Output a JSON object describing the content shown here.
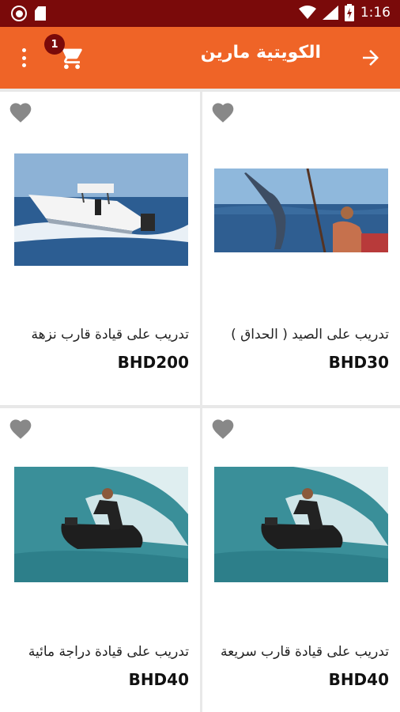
{
  "status_bar": {
    "time": "1:16"
  },
  "app_bar": {
    "title": "الكويتية مارين",
    "cart_count": "1"
  },
  "colors": {
    "accent": "#ef6427",
    "status_bar": "#7a0a0a",
    "heart": "#888888"
  },
  "products": [
    {
      "name": "تدريب على الصيد ( الحداق )",
      "price": "BHD30",
      "image": "marlin-fishing"
    },
    {
      "name": "تدريب على قيادة قارب نزهة",
      "price": "BHD200",
      "image": "speed-boat"
    },
    {
      "name": "تدريب على قيادة قارب سريعة",
      "price": "BHD40",
      "image": "jet-ski"
    },
    {
      "name": "تدريب على قيادة دراجة مائية",
      "price": "BHD40",
      "image": "jet-ski"
    }
  ]
}
